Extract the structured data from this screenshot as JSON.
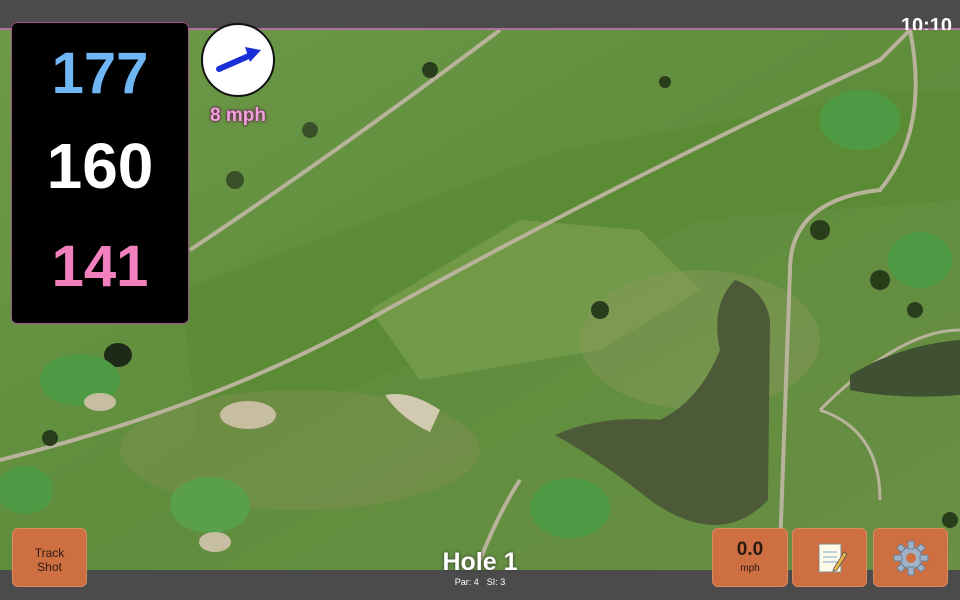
{
  "status": {
    "clock": "10:10"
  },
  "distances": {
    "back": "177",
    "middle": "160",
    "front": "141"
  },
  "wind": {
    "speed": "8 mph",
    "arrow_color": "#1a2fd8",
    "icon": "wind-arrow-icon"
  },
  "buttons": {
    "track_shot_line1": "Track",
    "track_shot_line2": "Shot",
    "speed_value": "0.0",
    "speed_unit": "mph",
    "notes_icon": "notepad-icon",
    "settings_icon": "gear-icon"
  },
  "hole": {
    "title": "Hole 1",
    "par": "Par: 4",
    "si": "SI: 3"
  },
  "colors": {
    "button": "#cd6f40",
    "back_distance": "#6fb6f5",
    "front_distance": "#f27fbe"
  }
}
